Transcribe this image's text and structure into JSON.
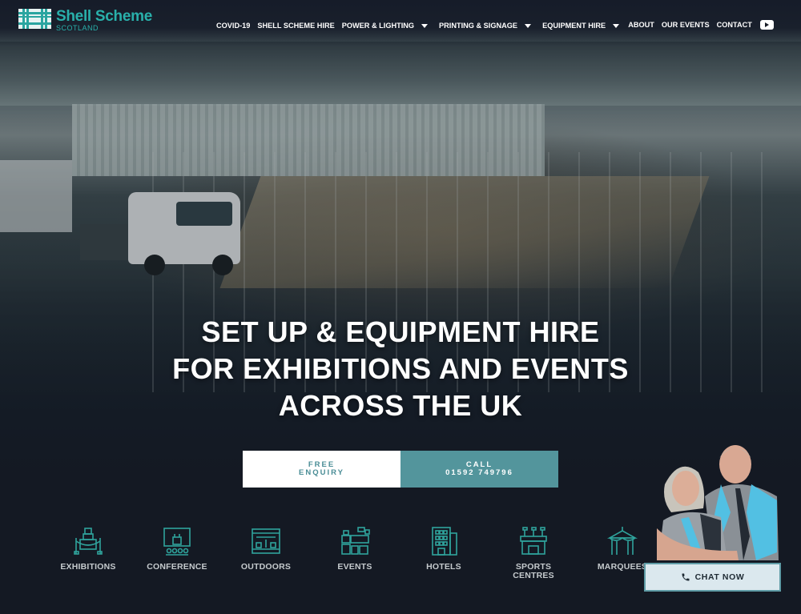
{
  "brand": {
    "name": "Shell Scheme",
    "subtitle": "SCOTLAND",
    "accent_color": "#29b0ab"
  },
  "nav": {
    "items": [
      {
        "label": "COVID-19",
        "has_dropdown": false
      },
      {
        "label": "SHELL SCHEME HIRE",
        "has_dropdown": false
      },
      {
        "label": "POWER & LIGHTING",
        "has_dropdown": true
      },
      {
        "label": "PRINTING & SIGNAGE",
        "has_dropdown": true
      },
      {
        "label": "EQUIPMENT HIRE",
        "has_dropdown": true
      },
      {
        "label": "ABOUT",
        "has_dropdown": false
      },
      {
        "label": "OUR EVENTS",
        "has_dropdown": false
      },
      {
        "label": "CONTACT",
        "has_dropdown": false
      }
    ],
    "social_icon": "youtube-icon"
  },
  "hero": {
    "title_lines": [
      "SET UP & EQUIPMENT HIRE",
      "FOR EXHIBITIONS AND EVENTS",
      "ACROSS THE UK"
    ],
    "background_image": "warehouse-exhibition-setup-photo"
  },
  "cta": {
    "free_enquiry": {
      "line1": "FREE",
      "line2": "ENQUIRY"
    },
    "call": {
      "line1": "CALL",
      "line2": "01592 749796"
    },
    "call_color": "#53959c"
  },
  "categories": [
    {
      "label": "EXHIBITIONS",
      "icon": "exhibition-stand-icon"
    },
    {
      "label": "CONFERENCE",
      "icon": "conference-podium-icon"
    },
    {
      "label": "OUTDOORS",
      "icon": "outdoor-stage-icon"
    },
    {
      "label": "EVENTS",
      "icon": "event-layout-icon"
    },
    {
      "label": "HOTELS",
      "icon": "hotel-building-icon"
    },
    {
      "label": "SPORTS CENTRES",
      "icon": "stadium-icon"
    },
    {
      "label": "MARQUEES",
      "icon": "marquee-tent-icon"
    }
  ],
  "chat": {
    "label": "CHAT NOW",
    "icon": "phone-icon",
    "photo": "owners-photo"
  }
}
